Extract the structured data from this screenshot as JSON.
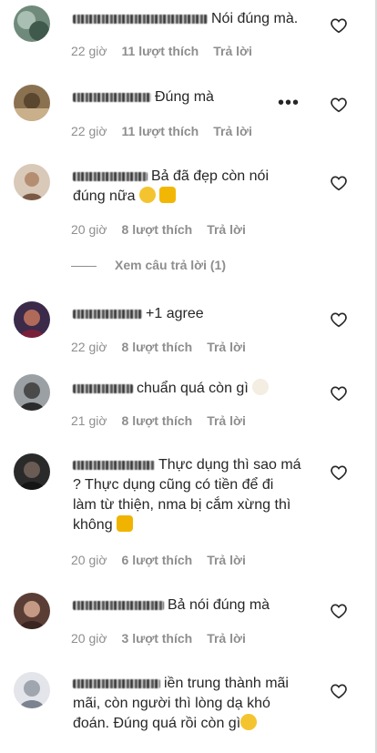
{
  "comments": [
    {
      "text": "Nói đúng mà.",
      "time": "22 giờ",
      "likes": "11 lượt thích",
      "reply": "Trả lời"
    },
    {
      "text": "Đúng mà",
      "time": "22 giờ",
      "likes": "11 lượt thích",
      "reply": "Trả lời",
      "more": "•••"
    },
    {
      "text": "Bả đã đẹp còn nói",
      "text2": "đúng nữa",
      "time": "20 giờ",
      "likes": "8 lượt thích",
      "reply": "Trả lời"
    },
    {
      "text": "+1 agree",
      "time": "22 giờ",
      "likes": "8 lượt thích",
      "reply": "Trả lời"
    },
    {
      "text": "chuẩn quá còn gì",
      "time": "21 giờ",
      "likes": "8 lượt thích",
      "reply": "Trả lời"
    },
    {
      "text": "Thực dụng thì sao má",
      "text2": "? Thực dụng cũng có tiền để đi",
      "text3": "làm từ thiện, nma bị cắm xừng thì",
      "text4": "không",
      "time": "20 giờ",
      "likes": "6 lượt thích",
      "reply": "Trả lời"
    },
    {
      "text": "Bả nói đúng mà",
      "time": "20 giờ",
      "likes": "3 lượt thích",
      "reply": "Trả lời"
    },
    {
      "text": "iền trung thành mãi",
      "text2": "mãi, còn người thì lòng dạ khó",
      "text3": "đoán. Đúng quá rồi còn gì"
    }
  ],
  "view_replies": "Xem câu trả lời (1)",
  "icons": {
    "like": "heart-icon",
    "more": "more-icon"
  }
}
